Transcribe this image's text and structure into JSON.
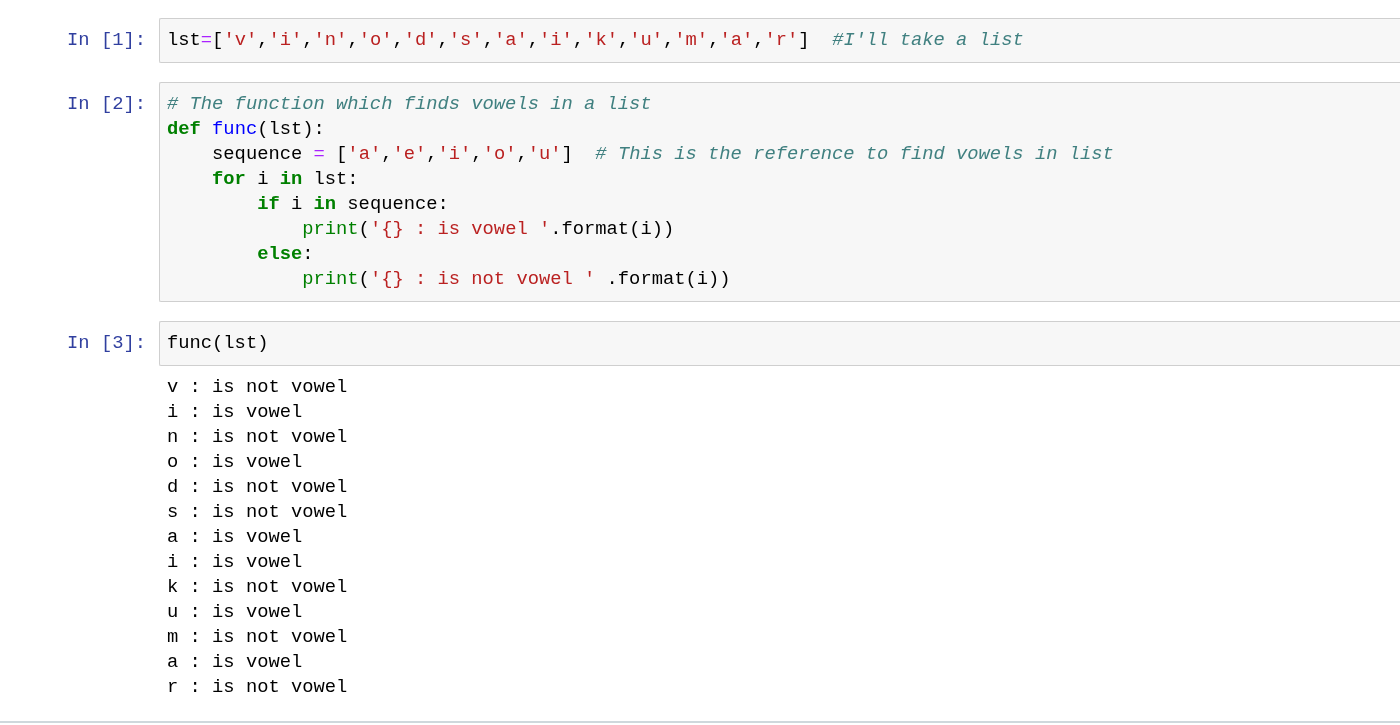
{
  "cells": [
    {
      "prompt": "In [1]:",
      "lines": [
        [
          {
            "kind": "plain",
            "text": "lst"
          },
          {
            "kind": "operator",
            "text": "="
          },
          {
            "kind": "plain",
            "text": "["
          },
          {
            "kind": "string",
            "text": "'v'"
          },
          {
            "kind": "plain",
            "text": ","
          },
          {
            "kind": "string",
            "text": "'i'"
          },
          {
            "kind": "plain",
            "text": ","
          },
          {
            "kind": "string",
            "text": "'n'"
          },
          {
            "kind": "plain",
            "text": ","
          },
          {
            "kind": "string",
            "text": "'o'"
          },
          {
            "kind": "plain",
            "text": ","
          },
          {
            "kind": "string",
            "text": "'d'"
          },
          {
            "kind": "plain",
            "text": ","
          },
          {
            "kind": "string",
            "text": "'s'"
          },
          {
            "kind": "plain",
            "text": ","
          },
          {
            "kind": "string",
            "text": "'a'"
          },
          {
            "kind": "plain",
            "text": ","
          },
          {
            "kind": "string",
            "text": "'i'"
          },
          {
            "kind": "plain",
            "text": ","
          },
          {
            "kind": "string",
            "text": "'k'"
          },
          {
            "kind": "plain",
            "text": ","
          },
          {
            "kind": "string",
            "text": "'u'"
          },
          {
            "kind": "plain",
            "text": ","
          },
          {
            "kind": "string",
            "text": "'m'"
          },
          {
            "kind": "plain",
            "text": ","
          },
          {
            "kind": "string",
            "text": "'a'"
          },
          {
            "kind": "plain",
            "text": ","
          },
          {
            "kind": "string",
            "text": "'r'"
          },
          {
            "kind": "plain",
            "text": "]  "
          },
          {
            "kind": "comment",
            "text": "#I'll take a list"
          }
        ]
      ]
    },
    {
      "prompt": "In [2]:",
      "lines": [
        [
          {
            "kind": "comment",
            "text": "# The function which finds vowels in a list"
          }
        ],
        [
          {
            "kind": "keyword",
            "text": "def "
          },
          {
            "kind": "funcname",
            "text": "func"
          },
          {
            "kind": "plain",
            "text": "(lst):"
          }
        ],
        [
          {
            "kind": "plain",
            "text": "    sequence "
          },
          {
            "kind": "operator",
            "text": "="
          },
          {
            "kind": "plain",
            "text": " ["
          },
          {
            "kind": "string",
            "text": "'a'"
          },
          {
            "kind": "plain",
            "text": ","
          },
          {
            "kind": "string",
            "text": "'e'"
          },
          {
            "kind": "plain",
            "text": ","
          },
          {
            "kind": "string",
            "text": "'i'"
          },
          {
            "kind": "plain",
            "text": ","
          },
          {
            "kind": "string",
            "text": "'o'"
          },
          {
            "kind": "plain",
            "text": ","
          },
          {
            "kind": "string",
            "text": "'u'"
          },
          {
            "kind": "plain",
            "text": "]  "
          },
          {
            "kind": "comment",
            "text": "# This is the reference to find vowels in list"
          }
        ],
        [
          {
            "kind": "keyword",
            "text": "    for"
          },
          {
            "kind": "plain",
            "text": " i "
          },
          {
            "kind": "keyword",
            "text": "in"
          },
          {
            "kind": "plain",
            "text": " lst:"
          }
        ],
        [
          {
            "kind": "keyword",
            "text": "        if"
          },
          {
            "kind": "plain",
            "text": " i "
          },
          {
            "kind": "keyword",
            "text": "in"
          },
          {
            "kind": "plain",
            "text": " sequence:"
          }
        ],
        [
          {
            "kind": "builtin",
            "text": "            print"
          },
          {
            "kind": "plain",
            "text": "("
          },
          {
            "kind": "string",
            "text": "'{} : is vowel '"
          },
          {
            "kind": "plain",
            "text": ".format(i))"
          }
        ],
        [
          {
            "kind": "keyword",
            "text": "        else"
          },
          {
            "kind": "plain",
            "text": ":"
          }
        ],
        [
          {
            "kind": "builtin",
            "text": "            print"
          },
          {
            "kind": "plain",
            "text": "("
          },
          {
            "kind": "string",
            "text": "'{} : is not vowel '"
          },
          {
            "kind": "plain",
            "text": " .format(i))"
          }
        ]
      ]
    },
    {
      "prompt": "In [3]:",
      "lines": [
        [
          {
            "kind": "plain",
            "text": "func(lst)"
          }
        ]
      ],
      "output": [
        "v : is not vowel",
        "i : is vowel",
        "n : is not vowel",
        "o : is vowel",
        "d : is not vowel",
        "s : is not vowel",
        "a : is vowel",
        "i : is vowel",
        "k : is not vowel",
        "u : is vowel",
        "m : is not vowel",
        "a : is vowel",
        "r : is not vowel"
      ]
    }
  ]
}
